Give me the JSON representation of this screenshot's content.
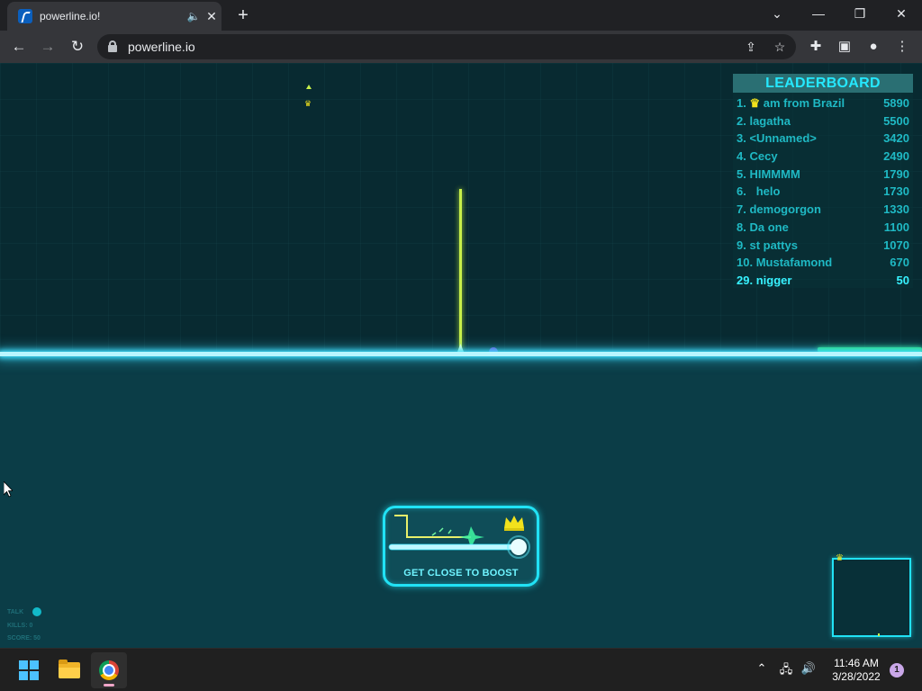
{
  "browser": {
    "tab_title": "powerline.io!",
    "url": "powerline.io"
  },
  "leaderboard": {
    "title": "LEADERBOARD",
    "entries": [
      {
        "rank": "1.",
        "name": "am from Brazil",
        "crown": true,
        "score": "5890"
      },
      {
        "rank": "2.",
        "name": "lagatha",
        "score": "5500"
      },
      {
        "rank": "3.",
        "name": "<Unnamed>",
        "score": "3420"
      },
      {
        "rank": "4.",
        "name": "Cecy",
        "score": "2490"
      },
      {
        "rank": "5.",
        "name": "HIMMMM",
        "score": "1790"
      },
      {
        "rank": "6.",
        "name": "  helo",
        "score": "1730"
      },
      {
        "rank": "7.",
        "name": "demogorgon",
        "score": "1330"
      },
      {
        "rank": "8.",
        "name": "Da one",
        "score": "1100"
      },
      {
        "rank": "9.",
        "name": "st pattys",
        "score": "1070"
      },
      {
        "rank": "10.",
        "name": "Mustafamond",
        "score": "670"
      }
    ],
    "self": {
      "rank": "29.",
      "name": "nigger",
      "score": "50"
    }
  },
  "tutorial": {
    "text": "GET CLOSE TO BOOST"
  },
  "stats": {
    "talk": "TALK",
    "kills": "KILLS: 0",
    "score": "SCORE: 50"
  },
  "taskbar": {
    "time": "11:46 AM",
    "date": "3/28/2022",
    "notifications": "1"
  },
  "colors": {
    "powerline": "#b9f6ff",
    "player": "#c8f04a",
    "leaderboard_title": "#25e8ff",
    "crown": "#f2e21c",
    "taskbar": "#202020"
  },
  "icons": [
    "back-icon",
    "forward-icon",
    "reload-icon",
    "lock-icon",
    "share-icon",
    "star-icon",
    "extensions-icon",
    "sidepanel-icon",
    "profile-icon",
    "menu-icon",
    "crown-icon",
    "windows-icon",
    "file-explorer-icon",
    "chrome-icon",
    "chevron-up-icon",
    "network-icon",
    "volume-icon"
  ]
}
